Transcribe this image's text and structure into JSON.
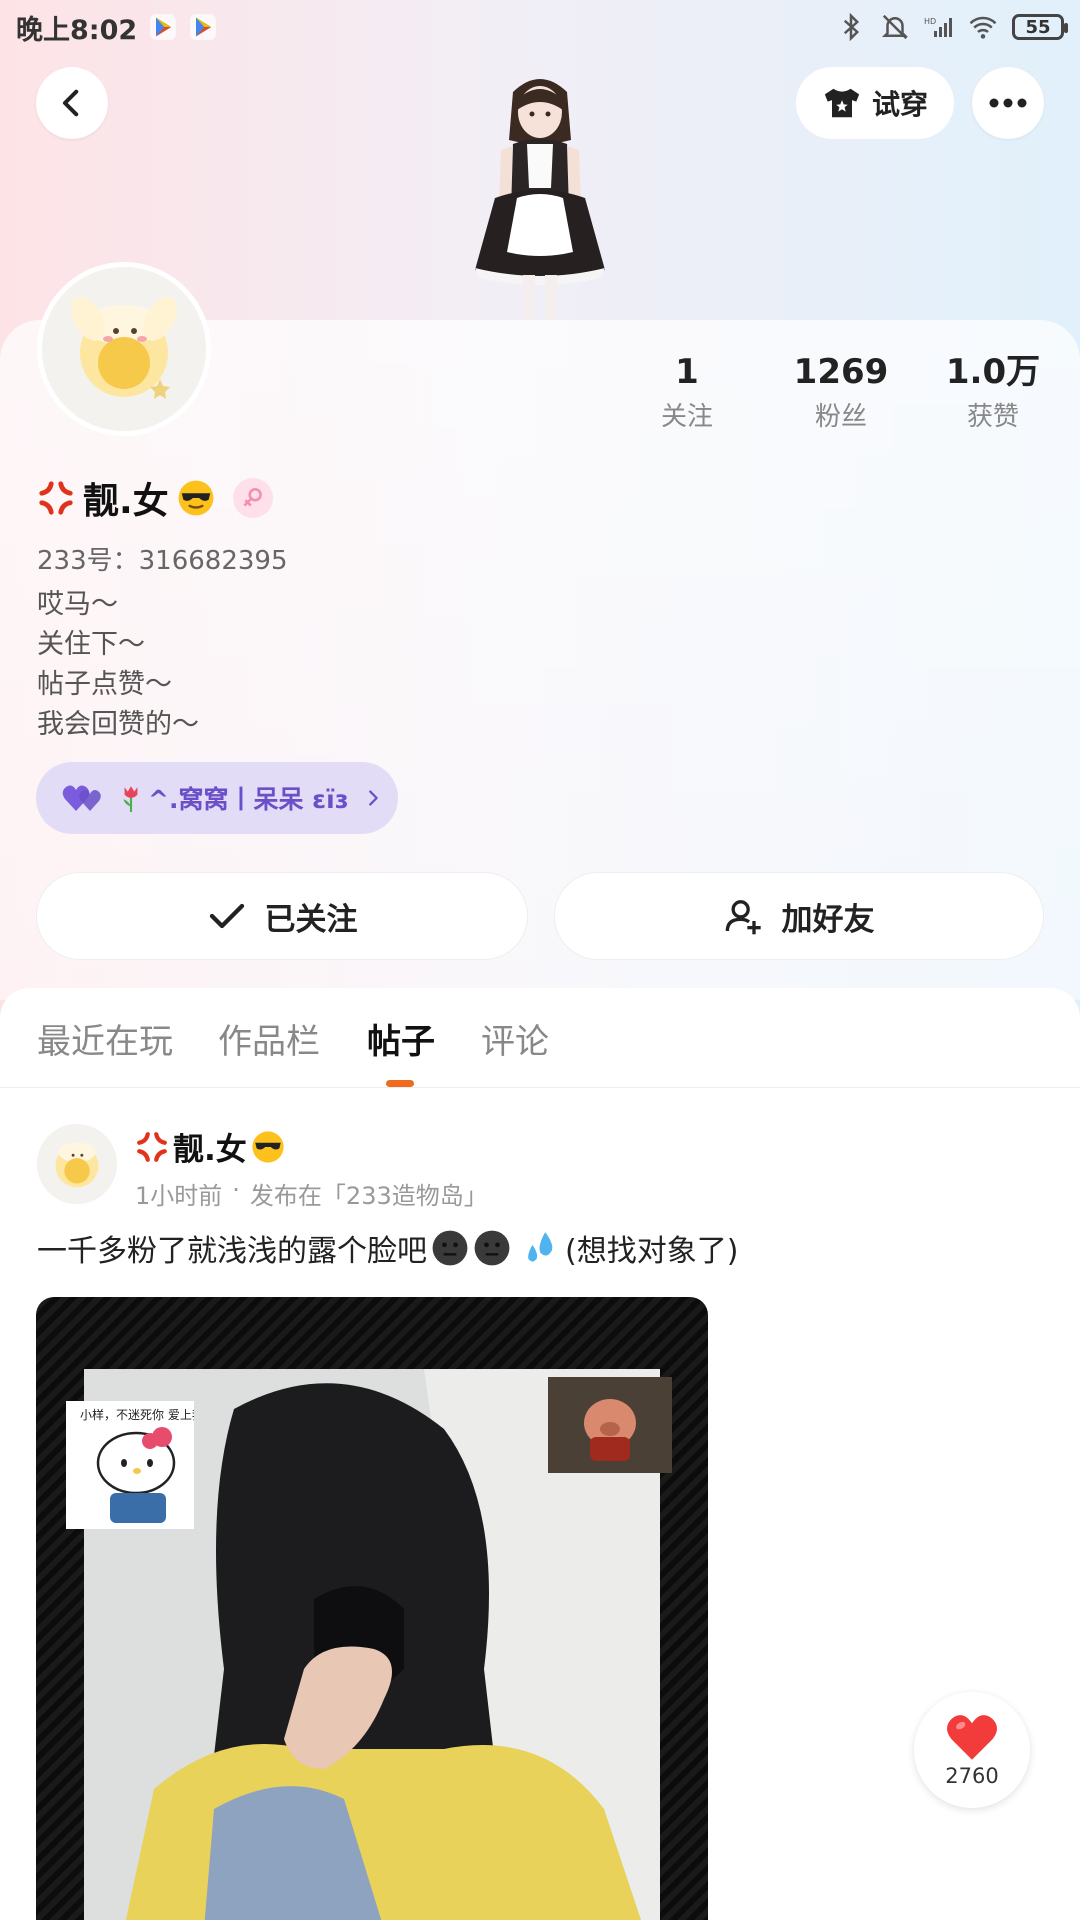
{
  "status_bar": {
    "time": "晚上8:02",
    "battery": "55",
    "icons": [
      "play-store-icon",
      "play-store-icon",
      "bluetooth-icon",
      "mute-icon",
      "hd-signal-icon",
      "wifi-icon",
      "battery-icon"
    ]
  },
  "header": {
    "tryon_label": "试穿",
    "icons": [
      "back-icon",
      "shirt-icon",
      "more-icon"
    ]
  },
  "profile": {
    "stats": [
      {
        "value": "1",
        "label": "关注"
      },
      {
        "value": "1269",
        "label": "粉丝"
      },
      {
        "value": "1.0万",
        "label": "获赞"
      }
    ],
    "username": "靓.女",
    "uid": "233号：316682395",
    "bio": [
      "哎马～",
      "关住下～",
      "帖子点赞～",
      "我会回赞的～"
    ],
    "cp_name": "^.窝窝丨呆呆 ɛïɜ",
    "follow_label": "已关注",
    "add_friend_label": "加好友",
    "colors": {
      "cp_bg": "#e3dcf6",
      "cp_text": "#6a4fc9",
      "tab_accent": "#f06a1e",
      "gender": "#f58fb1"
    }
  },
  "tabs": [
    {
      "label": "最近在玩",
      "active": false
    },
    {
      "label": "作品栏",
      "active": false
    },
    {
      "label": "帖子",
      "active": true
    },
    {
      "label": "评论",
      "active": false
    }
  ],
  "post": {
    "author": "靓.女",
    "time": "1小时前",
    "separator": "·",
    "location": "发布在「233造物岛」",
    "text_before": "一千多粉了就浅浅的露个脸吧",
    "text_after": "(想找对象了)",
    "sticker_cat_text": "小样，不迷死你 爱上我了吗 美眉",
    "like_count": "2760"
  }
}
